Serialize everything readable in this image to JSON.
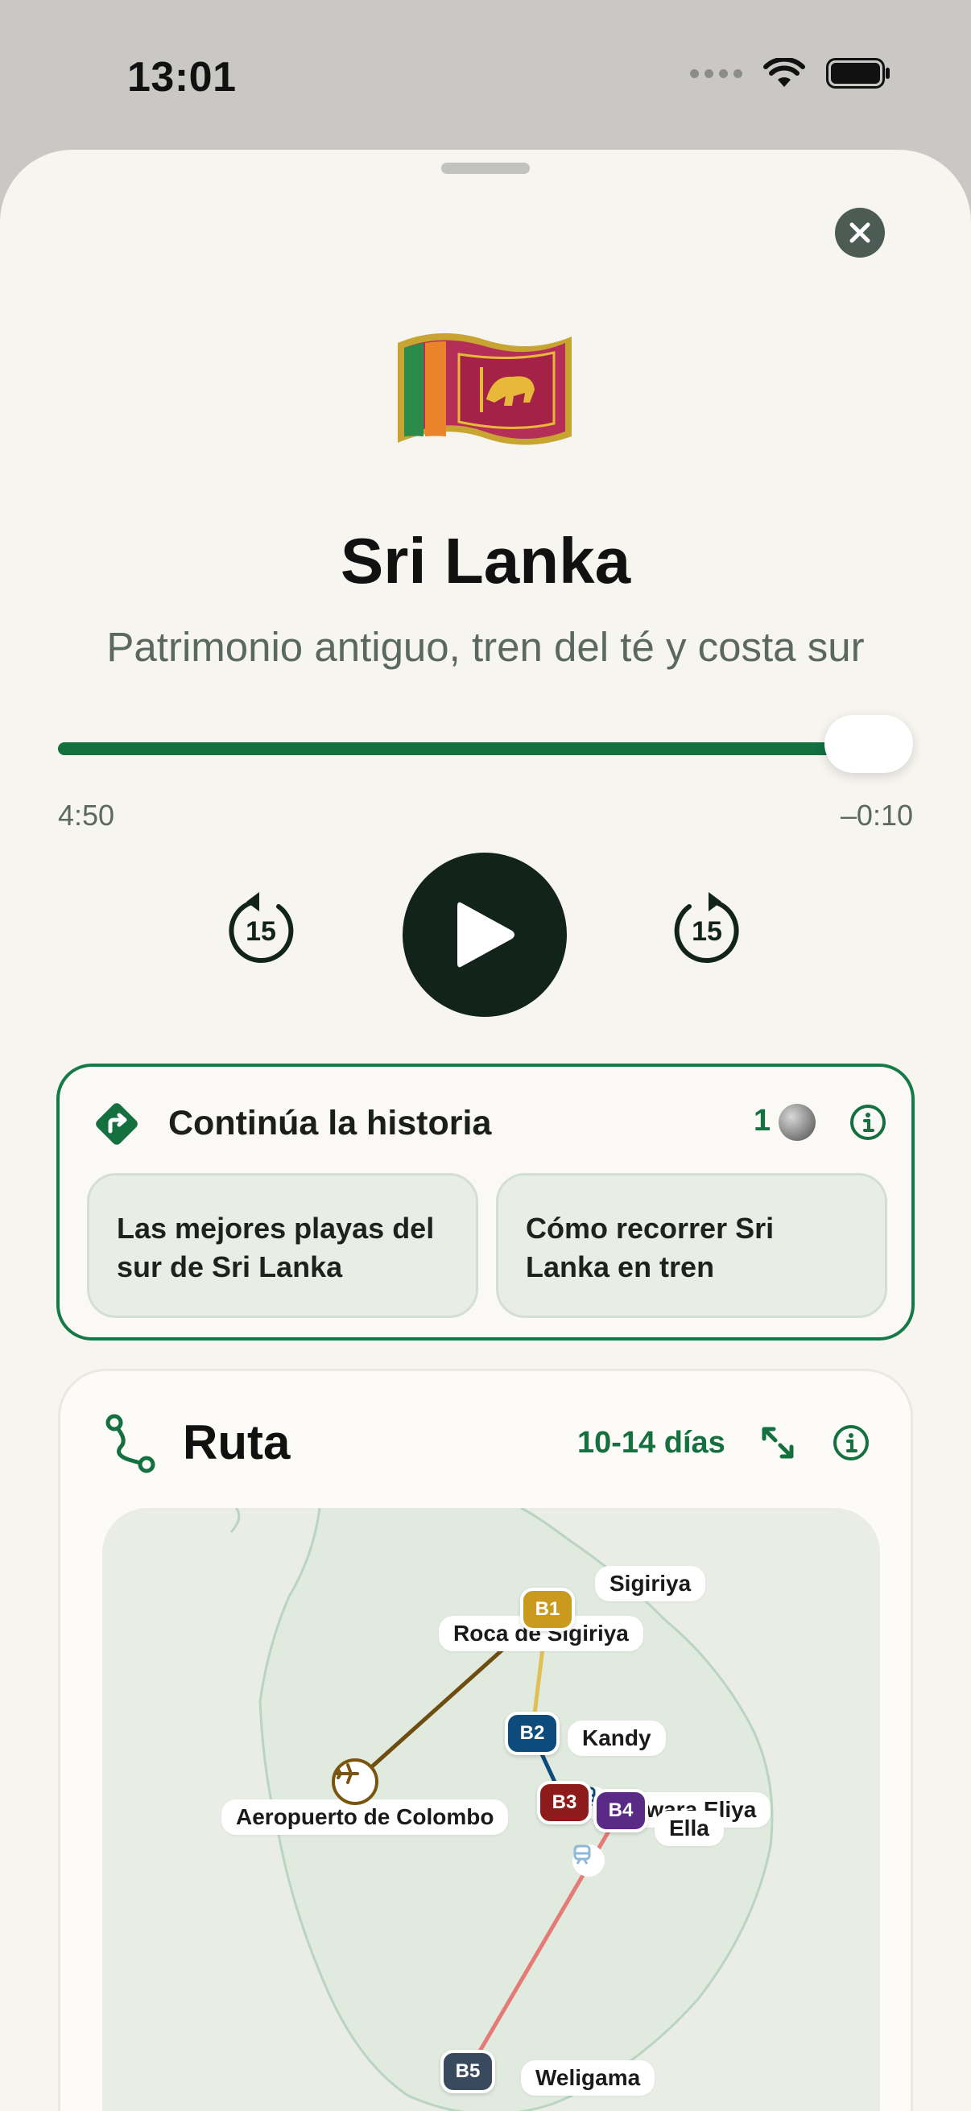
{
  "status_bar": {
    "time": "13:01"
  },
  "player": {
    "title": "Sri Lanka",
    "subtitle": "Patrimonio antiguo, tren del té y costa sur",
    "progress_fraction": 0.967,
    "elapsed": "4:50",
    "remaining": "–0:10",
    "skip_back_seconds": "15",
    "skip_forward_seconds": "15"
  },
  "continue_story": {
    "title": "Continúa la historia",
    "credits": "1",
    "items": [
      {
        "label": "Las mejores playas del sur de Sri Lanka"
      },
      {
        "label": "Cómo recorrer Sri Lanka en tren"
      }
    ]
  },
  "route": {
    "title": "Ruta",
    "duration": "10-14 días",
    "airport_label": "Aeropuerto de Colombo",
    "landmark_label": "Roca de Sigiriya",
    "stops": [
      {
        "code": "B1",
        "name": "Sigiriya",
        "color": "#c99a1e"
      },
      {
        "code": "B2",
        "name": "Kandy",
        "color": "#0d4b7c"
      },
      {
        "code": "B3",
        "name": "Nuwara Eliya",
        "color": "#8e1b1b"
      },
      {
        "code": "B4",
        "name": "Ella",
        "color": "#5b2a86"
      },
      {
        "code": "B5",
        "name": "Weligama",
        "color": "#3a4a5e"
      }
    ]
  },
  "colors": {
    "accent": "#14703f",
    "sheet_background": "#f7f5f0",
    "play_button": "#11231a"
  },
  "icons": {
    "close": "close-icon",
    "play": "play-icon",
    "skip_back": "skip-back-15-icon",
    "skip_forward": "skip-forward-15-icon",
    "continue": "directions-icon",
    "info": "info-icon",
    "route": "route-icon",
    "expand": "expand-icon",
    "airport": "airplane-icon",
    "train": "train-icon"
  }
}
